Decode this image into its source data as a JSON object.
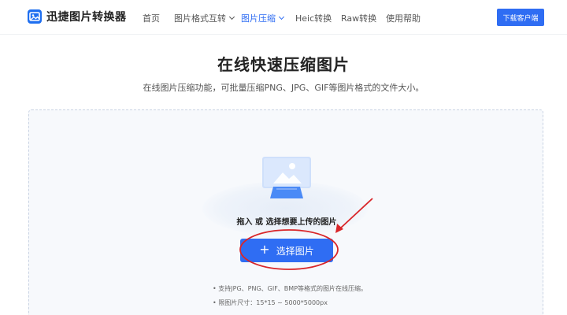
{
  "header": {
    "logo_text": "迅捷图片转换器",
    "nav": [
      {
        "label": "首页"
      },
      {
        "label": "图片格式互转"
      },
      {
        "label": "图片压缩"
      },
      {
        "label": "Heic转换"
      },
      {
        "label": "Raw转换"
      },
      {
        "label": "使用帮助"
      }
    ],
    "active_nav": "图片压缩",
    "download_label": "下载客户端"
  },
  "main": {
    "title": "在线快速压缩图片",
    "subtitle": "在线图片压缩功能，可批量压缩PNG、JPG、GIF等图片格式的文件大小。",
    "upload": {
      "drop_text": "拖入 或 选择想要上传的图片",
      "button_label": "选择图片",
      "button_icon": "plus-icon",
      "hints": [
        "• 支持JPG、PNG、GIF、BMP等格式的图片在线压缩。",
        "• 限图片尺寸：15*15 ~ 5000*5000px"
      ]
    }
  },
  "colors": {
    "accent": "#2f6df3",
    "annotation": "#d9262a"
  }
}
